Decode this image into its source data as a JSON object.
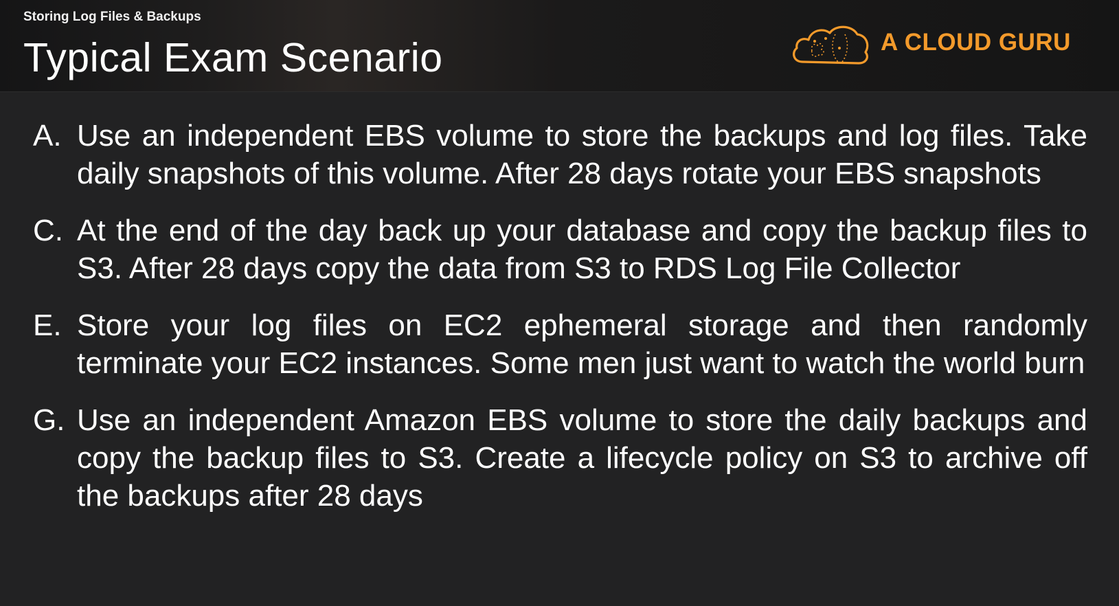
{
  "header": {
    "subtitle": "Storing Log Files & Backups",
    "title": "Typical Exam Scenario",
    "logo_text": "A CLOUD GURU",
    "logo_icon": "cloud-icon",
    "accent_color": "#f39a2b"
  },
  "options": [
    {
      "letter": "A.",
      "text": "Use an independent EBS volume to store the backups and log files. Take daily snapshots of this volume. After 28 days rotate your EBS snapshots"
    },
    {
      "letter": "C.",
      "text": "At the end of the day back up your database and copy the backup files to S3. After 28 days copy the data from S3 to RDS Log File Collector"
    },
    {
      "letter": "E.",
      "text": "Store your log files on EC2 ephemeral storage and then randomly terminate your EC2 instances. Some men just want to watch the world burn"
    },
    {
      "letter": "G.",
      "text": "Use an independent Amazon EBS volume to store the daily backups and copy the backup files to S3. Create a lifecycle policy on S3 to archive off the backups after 28 days"
    }
  ]
}
